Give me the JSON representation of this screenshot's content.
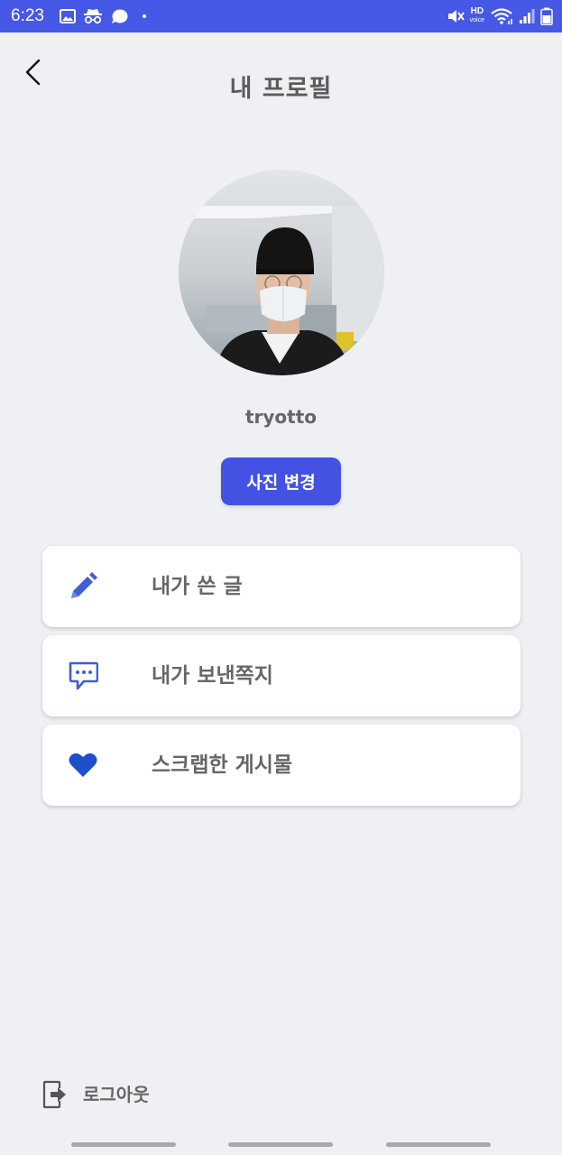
{
  "status_bar": {
    "time": "6:23",
    "background": "#4658e6",
    "left_icons": [
      "gallery-icon",
      "incognito-icon",
      "chat-bubble-icon",
      "dot-icon"
    ],
    "right_icons": [
      "mute-icon",
      "hd-voice-icon",
      "wifi-icon",
      "signal-icon",
      "battery-icon"
    ],
    "hd_label": "HD",
    "voice_label": "voice"
  },
  "header": {
    "back_icon": "chevron-left-icon",
    "title": "내 프로필"
  },
  "profile": {
    "avatar": "profile-photo",
    "username": "tryotto",
    "change_photo_label": "사진 변경",
    "accent": "#4452e4"
  },
  "menu": {
    "items": [
      {
        "icon": "pencil-icon",
        "label": "내가 쓴 글"
      },
      {
        "icon": "message-icon",
        "label": "내가 보낸쪽지"
      },
      {
        "icon": "heart-icon",
        "label": "스크랩한 게시물"
      }
    ],
    "icon_color": "#3d5ed6"
  },
  "footer": {
    "logout_icon": "logout-icon",
    "logout_label": "로그아웃"
  },
  "nav_bar": {
    "pills": [
      "nav-pill-recent",
      "nav-pill-home",
      "nav-pill-back"
    ]
  }
}
